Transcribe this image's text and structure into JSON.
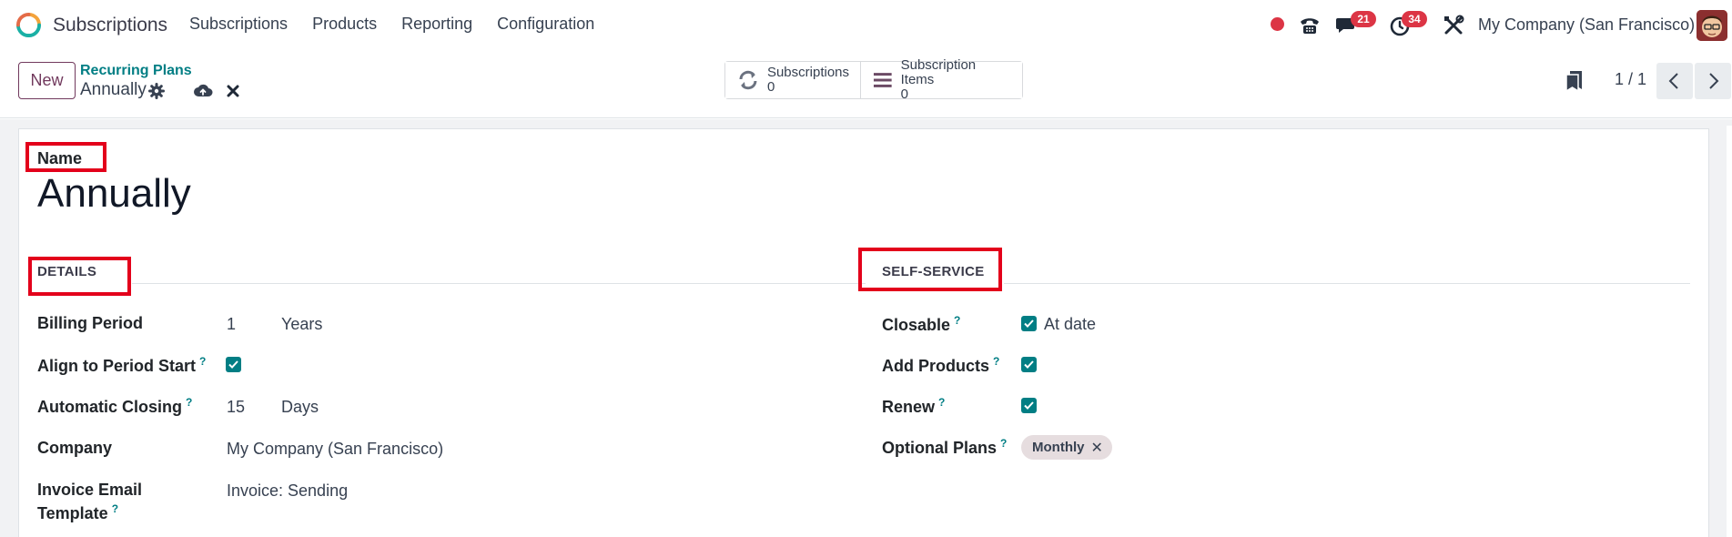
{
  "navbar": {
    "app_name": "Subscriptions",
    "menu": [
      "Subscriptions",
      "Products",
      "Reporting",
      "Configuration"
    ],
    "messages_count": "21",
    "activities_count": "34",
    "company": "My Company (San Francisco)"
  },
  "control": {
    "new_label": "New",
    "breadcrumb_parent": "Recurring Plans",
    "record_name": "Annually",
    "smart_buttons": [
      {
        "label": "Subscriptions",
        "count": "0",
        "icon": "refresh-icon"
      },
      {
        "label": "Subscription Items",
        "count": "0",
        "icon": "list-icon"
      }
    ],
    "pager": "1 / 1"
  },
  "form": {
    "name_label": "Name",
    "name_value": "Annually",
    "details": {
      "title": "DETAILS",
      "billing_period_label": "Billing Period",
      "billing_period_value": "1",
      "billing_period_unit": "Years",
      "align_label": "Align to Period Start",
      "align_checked": true,
      "auto_close_label": "Automatic Closing",
      "auto_close_value": "15",
      "auto_close_unit": "Days",
      "company_label": "Company",
      "company_value": "My Company (San Francisco)",
      "invoice_label_1": "Invoice Email",
      "invoice_label_2": "Template",
      "invoice_value": "Invoice: Sending"
    },
    "self_service": {
      "title": "SELF-SERVICE",
      "closable_label": "Closable",
      "closable_checked": true,
      "closable_option": "At date",
      "add_products_label": "Add Products",
      "add_products_checked": true,
      "renew_label": "Renew",
      "renew_checked": true,
      "optional_plans_label": "Optional Plans",
      "optional_plans": [
        "Monthly"
      ]
    },
    "help_mark": "?"
  },
  "colors": {
    "primary": "#71395d",
    "teal": "#017e84",
    "badge_red": "#dc3545",
    "highlight_red": "#e3001b"
  }
}
